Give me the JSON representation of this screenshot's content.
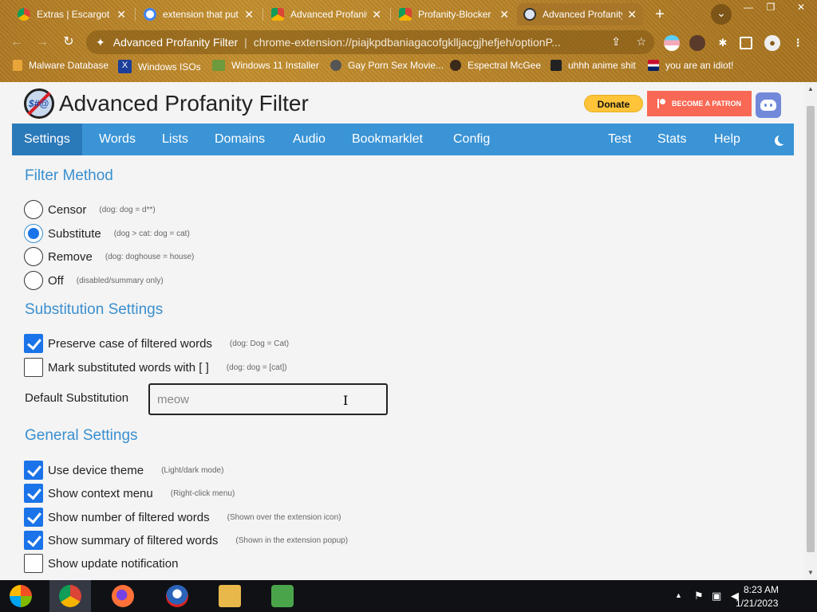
{
  "browser": {
    "tabs": [
      {
        "title": "Extras | Escargot",
        "icon": "chrome-web-store-icon",
        "active": false
      },
      {
        "title": "extension that put",
        "icon": "google-icon",
        "active": false
      },
      {
        "title": "Advanced Profanity",
        "icon": "webstore-icon",
        "active": false
      },
      {
        "title": "Profanity-Blocker",
        "icon": "webstore-icon",
        "active": false
      },
      {
        "title": "Advanced Profanity",
        "icon": "profanity-filter-icon",
        "active": true
      }
    ],
    "new_tab_glyph": "+",
    "tab_close_glyph": "✕",
    "window_controls": {
      "minimize": "—",
      "restore": "❐",
      "close": "✕"
    },
    "tab_search_glyph": "⌄",
    "omnibox": {
      "site_name": "Advanced Profanity Filter",
      "separator": "|",
      "url": "chrome-extension://piajkpdbaniagacofgklljacgjhefjeh/optionP..."
    },
    "nav": {
      "back": "←",
      "forward": "→",
      "reload": "↻"
    },
    "bookmarks": [
      {
        "label": "Malware Database",
        "icon": "folder-icon"
      },
      {
        "label": "Windows ISOs",
        "icon": "x-icon"
      },
      {
        "label": "Windows 11 Installer",
        "icon": "installer-icon"
      },
      {
        "label": "Gay Porn Sex Movie...",
        "icon": "globe-icon"
      },
      {
        "label": "Espectral McGee",
        "icon": "avatar-icon"
      },
      {
        "label": "uhhh anime shit",
        "icon": "anime-icon"
      },
      {
        "label": "you are an idiot!",
        "icon": "uk-flag-icon"
      }
    ]
  },
  "app": {
    "title": "Advanced Profanity Filter",
    "donate_label": "Donate",
    "patron_label": "BECOME A PATRON",
    "menu": [
      "Settings",
      "Words",
      "Lists",
      "Domains",
      "Audio",
      "Bookmarklet",
      "Config"
    ],
    "menu_right": [
      "Test",
      "Stats",
      "Help"
    ],
    "active_menu": "Settings"
  },
  "filter_method": {
    "title": "Filter Method",
    "options": [
      {
        "label": "Censor",
        "note": "(dog: dog = d**)",
        "selected": false
      },
      {
        "label": "Substitute",
        "note": "(dog > cat: dog = cat)",
        "selected": true
      },
      {
        "label": "Remove",
        "note": "(dog: doghouse = house)",
        "selected": false
      },
      {
        "label": "Off",
        "note": "(disabled/summary only)",
        "selected": false
      }
    ]
  },
  "substitution": {
    "title": "Substitution Settings",
    "options": [
      {
        "label": "Preserve case of filtered words",
        "note": "(dog: Dog = Cat)",
        "checked": true
      },
      {
        "label": "Mark substituted words with [ ]",
        "note": "(dog: dog = [cat])",
        "checked": false
      }
    ],
    "default_label": "Default Substitution",
    "default_value": "meow"
  },
  "general": {
    "title": "General Settings",
    "options": [
      {
        "label": "Use device theme",
        "note": "(Light/dark mode)",
        "checked": true
      },
      {
        "label": "Show context menu",
        "note": "(Right-click menu)",
        "checked": true
      },
      {
        "label": "Show number of filtered words",
        "note": "(Shown over the extension icon)",
        "checked": true
      },
      {
        "label": "Show summary of filtered words",
        "note": "(Shown in the extension popup)",
        "checked": true
      },
      {
        "label": "Show update notification",
        "note": "",
        "checked": false
      }
    ]
  },
  "taskbar": {
    "time": "8:23 AM",
    "date": "1/21/2023",
    "tray_arrow": "▲"
  },
  "colors": {
    "menu_bg": "#3a94d6",
    "menu_active": "#2a79b9",
    "section_title": "#3a8fd0",
    "checkbox_on": "#1a73e8",
    "donate": "#ffc439",
    "patreon": "#f96854",
    "discord": "#7289da"
  }
}
